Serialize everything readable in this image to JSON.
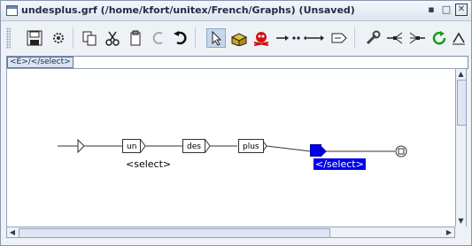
{
  "window": {
    "title": "undesplus.grf (/home/kfort/unitex/French/Graphs) (Unsaved)"
  },
  "icons": {
    "title": "window-icon",
    "toolbar": [
      "save-icon",
      "compile-icon",
      "copy-icon",
      "cut-icon",
      "paste-icon",
      "redo-icon",
      "undo-icon",
      "select-arrow-icon",
      "open-box-icon",
      "delete-box-icon",
      "connect-icon",
      "connect-nodes-icon",
      "output-box-icon",
      "tools-icon",
      "branch-icon",
      "merge-icon",
      "refresh-icon",
      "sort-icon"
    ]
  },
  "combo": {
    "value": "<E>/</select>"
  },
  "graph": {
    "boxes": [
      "un",
      "des",
      "plus"
    ],
    "outputs": [
      "<select>",
      "</select>"
    ]
  }
}
